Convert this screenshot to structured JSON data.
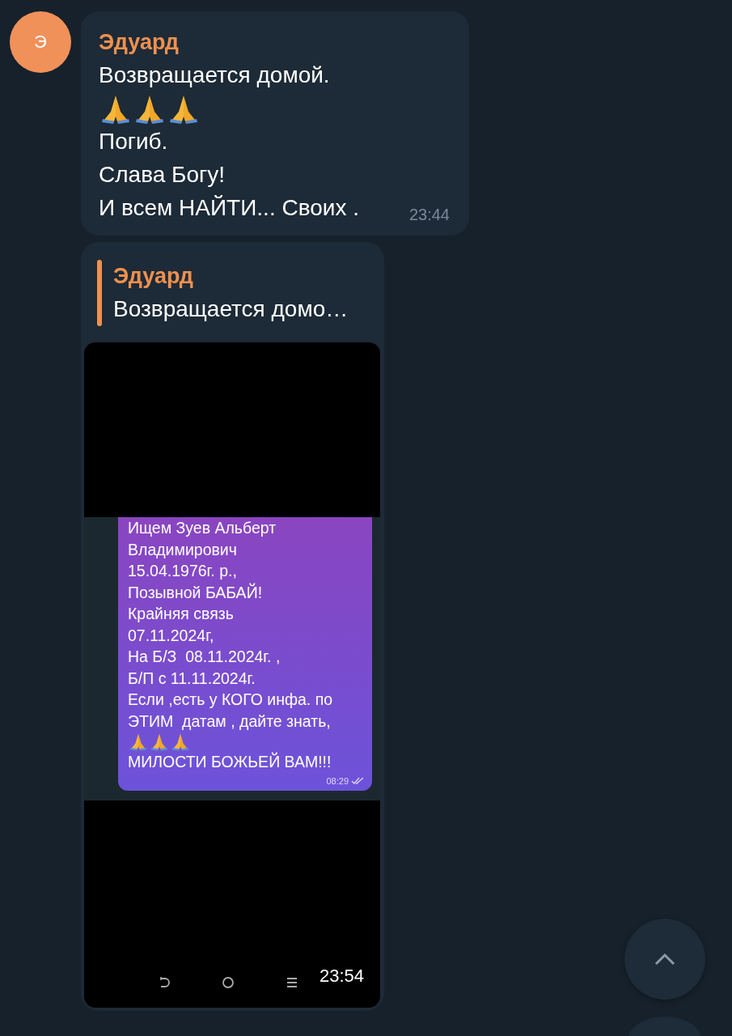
{
  "messages": [
    {
      "kind": "text",
      "avatar_letter": "Э",
      "sender": "Эдуард",
      "lines": [
        {
          "kind": "text",
          "text": "Возвращается домой."
        },
        {
          "kind": "prayer"
        },
        {
          "kind": "text",
          "text": "Погиб."
        },
        {
          "kind": "text",
          "text": "Слава Богу!"
        },
        {
          "kind": "text",
          "text": "И всем НАЙТИ... Своих ."
        }
      ],
      "time": "23:44"
    },
    {
      "kind": "reply-image",
      "reply": {
        "sender": "Эдуард",
        "text": "Возвращается домо…"
      },
      "image": {
        "bubble_lines": [
          {
            "kind": "text",
            "text": "Ищем Зуев Альберт"
          },
          {
            "kind": "text",
            "text": "Владимирович"
          },
          {
            "kind": "text",
            "text": "15.04.1976г. р.,"
          },
          {
            "kind": "text",
            "text": "Позывной БАБАЙ!"
          },
          {
            "kind": "text",
            "text": "Крайняя связь"
          },
          {
            "kind": "text",
            "text": "07.11.2024г,"
          },
          {
            "kind": "text",
            "text": "На Б/З  08.11.2024г. ,"
          },
          {
            "kind": "text",
            "text": "Б/П с 11.11.2024г."
          },
          {
            "kind": "text",
            "text": "Если ,есть у КОГО инфа. по"
          },
          {
            "kind": "text",
            "text": "ЭТИМ  датам , дайте знать,"
          },
          {
            "kind": "prayer"
          },
          {
            "kind": "text",
            "text": "МИЛОСТИ БОЖЬЕЙ ВАМ!!!"
          }
        ],
        "bubble_time": "08:29"
      },
      "time": "23:54"
    }
  ]
}
